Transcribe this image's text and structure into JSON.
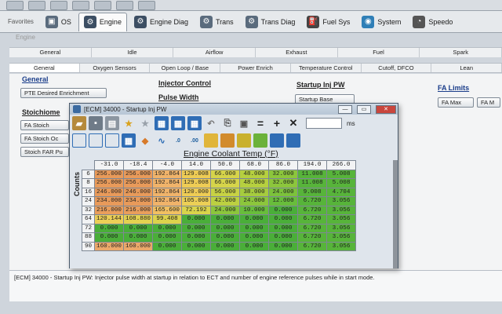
{
  "toolbar_top": {
    "favorites": "Favorites",
    "tabs": [
      {
        "label": "OS",
        "icon": "chip-icon",
        "color": "#5a6b7d"
      },
      {
        "label": "Engine",
        "icon": "engine-icon",
        "color": "#3c4e63"
      },
      {
        "label": "Engine Diag",
        "icon": "engine-diag-icon",
        "color": "#3c4e63"
      },
      {
        "label": "Trans",
        "icon": "trans-icon",
        "color": "#5a6b7d"
      },
      {
        "label": "Trans Diag",
        "icon": "trans-diag-icon",
        "color": "#5a6b7d"
      },
      {
        "label": "Fuel Sys",
        "icon": "fuel-sys-icon",
        "color": "#444"
      },
      {
        "label": "System",
        "icon": "system-icon",
        "color": "#2f7fb7"
      },
      {
        "label": "Speedo",
        "icon": "speedo-icon",
        "color": "#555"
      }
    ]
  },
  "breadcrumb": "Engine",
  "subtabs_row1": [
    "General",
    "Idle",
    "Airflow",
    "Exhaust",
    "Fuel",
    "Spark"
  ],
  "subtabs_row2": [
    "General",
    "Oxygen Sensors",
    "Open Loop / Base",
    "Power Enrich",
    "Temperature Control",
    "Cutoff, DFCO",
    "Lean"
  ],
  "content": {
    "general_heading": "General",
    "pte_button": "PTE Desired Enrichment",
    "stoich_heading": "Stoichiome",
    "fa_stoich": "FA Stoich",
    "fa_stoich_oc": "FA Stoich Oc",
    "stoich_far": "Stoich FAR Pu",
    "injector_heading": "Injector Control",
    "pulse_heading": "Pulse Width",
    "startup_heading": "Startup Inj PW",
    "startup_base": "Startup Base",
    "fa_limits_heading": "FA Limits",
    "fa_max": "FA Max",
    "fa_m": "FA M"
  },
  "status_text": "[ECM] 34000 - Startup Inj PW: Injector pulse width at startup in relation to ECT and number of engine reference pulses while in start mode.",
  "window": {
    "title": "[ECM] 34000 - Startup Inj PW",
    "unit": "ms",
    "btn_min": "—",
    "btn_max": "▭",
    "btn_close": "✕"
  },
  "chart_data": {
    "type": "table",
    "title": "Engine Coolant Temp (°F)",
    "ylabel": "Counts",
    "columns": [
      "-31.0",
      "-18.4",
      "-4.0",
      "14.0",
      "50.0",
      "68.0",
      "86.0",
      "194.0",
      "266.0"
    ],
    "rows": [
      {
        "count": "6",
        "values": [
          "256.000",
          "256.000",
          "192.864",
          "129.008",
          "66.000",
          "48.000",
          "32.000",
          "11.008",
          "5.008"
        ],
        "colors": [
          "#e89a5a",
          "#e89a5a",
          "#f0b36a",
          "#eecc55",
          "#d6d44a",
          "#b6d03f",
          "#8cc63c",
          "#57b43a",
          "#57b43a"
        ]
      },
      {
        "count": "8",
        "values": [
          "256.000",
          "256.000",
          "192.864",
          "129.008",
          "66.000",
          "48.000",
          "32.000",
          "11.008",
          "5.008"
        ],
        "colors": [
          "#e89a5a",
          "#e89a5a",
          "#f0b36a",
          "#eecc55",
          "#d6d44a",
          "#b6d03f",
          "#8cc63c",
          "#57b43a",
          "#57b43a"
        ]
      },
      {
        "count": "16",
        "values": [
          "246.000",
          "246.000",
          "192.864",
          "120.000",
          "56.000",
          "38.000",
          "24.000",
          "9.008",
          "4.704"
        ],
        "colors": [
          "#e89a5a",
          "#e89a5a",
          "#f0b36a",
          "#eecc55",
          "#c8d244",
          "#a6cc3e",
          "#7cc23b",
          "#57b43a",
          "#57b43a"
        ]
      },
      {
        "count": "24",
        "values": [
          "234.000",
          "234.000",
          "192.864",
          "105.008",
          "42.000",
          "24.000",
          "12.000",
          "6.720",
          "3.056"
        ],
        "colors": [
          "#e89a5a",
          "#e89a5a",
          "#f0b36a",
          "#eccf56",
          "#bcd041",
          "#8cc63c",
          "#68bd3b",
          "#57b43a",
          "#57b43a"
        ]
      },
      {
        "count": "32",
        "values": [
          "216.000",
          "216.000",
          "165.600",
          "72.192",
          "24.000",
          "10.000",
          "0.000",
          "6.720",
          "3.056"
        ],
        "colors": [
          "#e99e5c",
          "#e99e5c",
          "#f1c062",
          "#d9d44b",
          "#8cc63c",
          "#68bd3b",
          "#4aae39",
          "#57b43a",
          "#57b43a"
        ]
      },
      {
        "count": "64",
        "values": [
          "120.144",
          "108.880",
          "99.408",
          "0.000",
          "0.000",
          "0.000",
          "0.000",
          "6.720",
          "3.056"
        ],
        "colors": [
          "#eccf56",
          "#e4d250",
          "#dcd34c",
          "#4aae39",
          "#4aae39",
          "#4aae39",
          "#4aae39",
          "#57b43a",
          "#57b43a"
        ]
      },
      {
        "count": "72",
        "values": [
          "0.000",
          "0.000",
          "0.000",
          "0.000",
          "0.000",
          "0.000",
          "0.000",
          "6.720",
          "3.056"
        ],
        "colors": [
          "#4aae39",
          "#4aae39",
          "#4aae39",
          "#4aae39",
          "#4aae39",
          "#4aae39",
          "#4aae39",
          "#57b43a",
          "#57b43a"
        ]
      },
      {
        "count": "88",
        "values": [
          "0.000",
          "0.000",
          "0.000",
          "0.000",
          "0.000",
          "0.000",
          "0.000",
          "6.720",
          "3.056"
        ],
        "colors": [
          "#4aae39",
          "#4aae39",
          "#4aae39",
          "#4aae39",
          "#4aae39",
          "#4aae39",
          "#4aae39",
          "#57b43a",
          "#57b43a"
        ]
      },
      {
        "count": "90",
        "values": [
          "160.000",
          "160.000",
          "0.000",
          "0.000",
          "0.000",
          "0.000",
          "0.000",
          "6.720",
          "3.056"
        ],
        "colors": [
          "#eba86a",
          "#eba86a",
          "#4aae39",
          "#4aae39",
          "#4aae39",
          "#4aae39",
          "#4aae39",
          "#57b43a",
          "#57b43a"
        ]
      }
    ]
  }
}
